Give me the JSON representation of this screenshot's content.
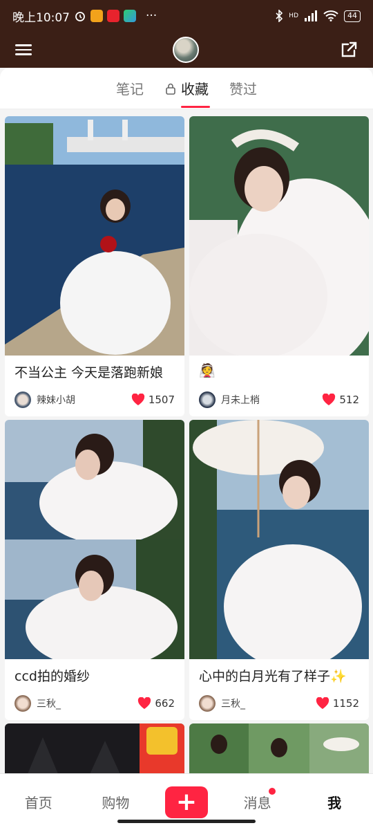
{
  "status_bar": {
    "time": "晚上10:07",
    "dots": "···",
    "network": "HD",
    "battery": "44"
  },
  "profile_tabs": [
    {
      "label": "笔记",
      "active": false
    },
    {
      "label": "收藏",
      "active": true,
      "locked": true
    },
    {
      "label": "赞过",
      "active": false
    }
  ],
  "cards": [
    {
      "title": "不当公主 今天是落跑新娘",
      "author": "辣妹小胡",
      "likes": "1507"
    },
    {
      "title": "👰",
      "author": "月未上梢",
      "likes": "512"
    },
    {
      "title": "ccd拍的婚纱",
      "author": "三秋_",
      "likes": "662"
    },
    {
      "title": "心中的白月光有了样子✨",
      "author": "三秋_",
      "likes": "1152"
    }
  ],
  "bottom_nav": {
    "home": "首页",
    "shop": "购物",
    "publish": "+",
    "messages": "消息",
    "me": "我"
  },
  "colors": {
    "accent": "#ff2442",
    "header_bg": "#3b1f16"
  }
}
